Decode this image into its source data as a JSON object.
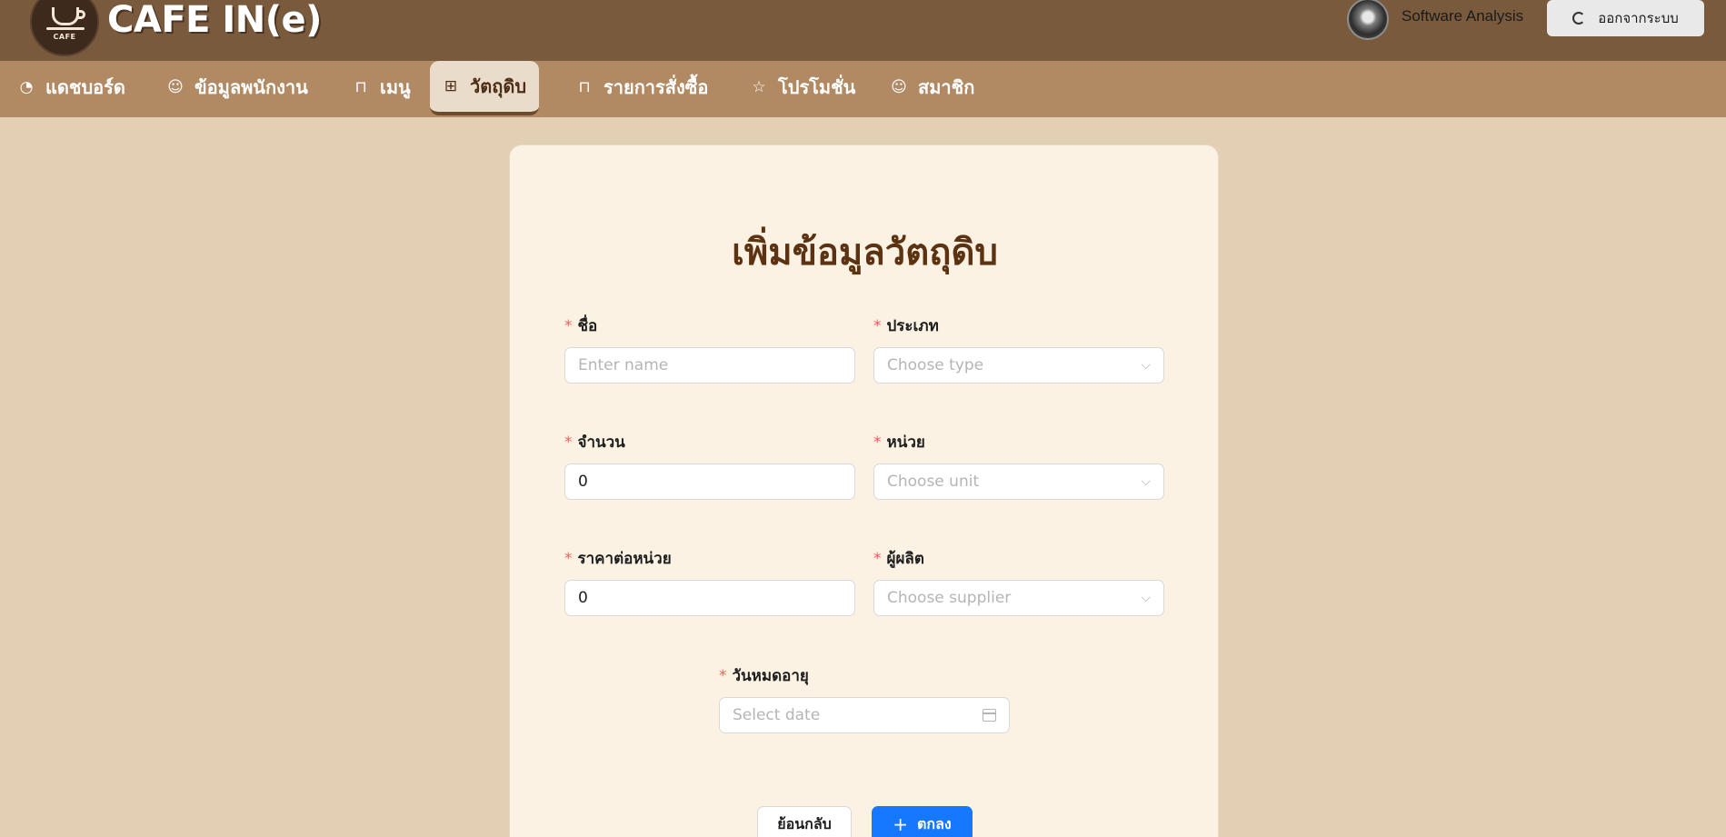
{
  "header": {
    "brand": "CAFE IN(e)",
    "logo_word": "CAFE",
    "user_name": "Software Analysis",
    "logout_label": "ออกจากระบบ"
  },
  "nav": {
    "items": [
      {
        "label": "แดชบอร์ด",
        "icon": "dashboard-icon"
      },
      {
        "label": "ข้อมูลพนักงาน",
        "icon": "user-icon"
      },
      {
        "label": "เมนู",
        "icon": "bag-icon"
      },
      {
        "label": "วัตถุดิบ",
        "icon": "grid-icon",
        "active": true
      },
      {
        "label": "รายการสั่งซื้อ",
        "icon": "bag-icon"
      },
      {
        "label": "โปรโมชั่น",
        "icon": "star-icon"
      },
      {
        "label": "สมาชิก",
        "icon": "user-icon"
      }
    ]
  },
  "form": {
    "title": "เพิ่มข้อมูลวัตถุดิบ",
    "name": {
      "label": "ชื่อ",
      "placeholder": "Enter name"
    },
    "type": {
      "label": "ประเภท",
      "placeholder": "Choose type"
    },
    "quantity": {
      "label": "จำนวน",
      "value": "0"
    },
    "unit": {
      "label": "หน่วย",
      "placeholder": "Choose unit"
    },
    "price": {
      "label": "ราคาต่อหน่วย",
      "value": "0"
    },
    "supplier": {
      "label": "ผู้ผลิต",
      "placeholder": "Choose supplier"
    },
    "expiry": {
      "label": "วันหมดอายุ",
      "placeholder": "Select date"
    },
    "required_mark": "*",
    "back_label": "ย้อนกลับ",
    "ok_label": "ตกลง"
  }
}
